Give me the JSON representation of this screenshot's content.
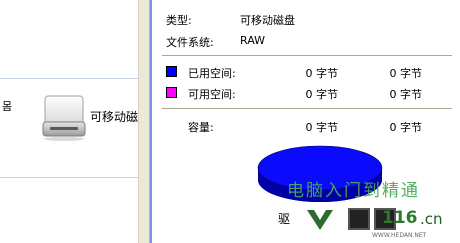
{
  "explorer": {
    "side_glyph": "몸",
    "drive_label": "可移动磁盘"
  },
  "properties": {
    "type_label": "类型:",
    "type_value": "可移动磁盘",
    "fs_label": "文件系统:",
    "fs_value": "RAW",
    "used": {
      "label": "已用空间:",
      "value1": "0 字节",
      "value2": "0 字节",
      "color": "#0000ff"
    },
    "free": {
      "label": "可用空间:",
      "value1": "0 字节",
      "value2": "0 字节",
      "color": "#ff00ff"
    },
    "capacity": {
      "label": "容量:",
      "value1": "0 字节",
      "value2": "0 字节"
    },
    "drive_prefix": "驱"
  },
  "watermark": {
    "title": "电脑入门到精通",
    "number": "116",
    "suffix": ".cn",
    "url": "WWW.HEDAN.NET"
  }
}
